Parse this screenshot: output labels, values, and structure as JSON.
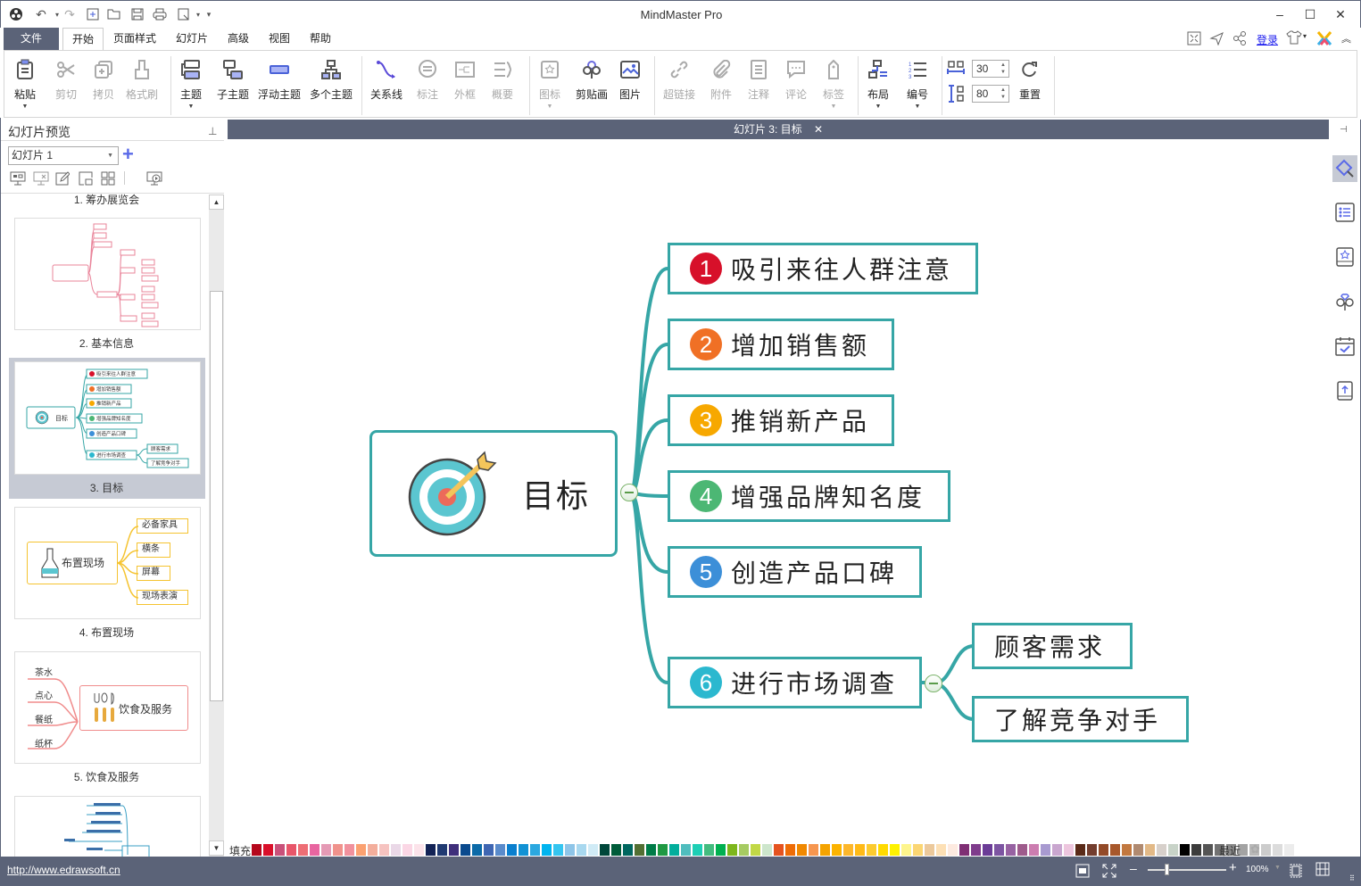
{
  "app": {
    "title": "MindMaster Pro"
  },
  "quick_access": [
    "app-logo",
    "undo",
    "redo",
    "new",
    "open",
    "save",
    "print",
    "export",
    "customize"
  ],
  "menu": {
    "file": "文件",
    "tabs": [
      "开始",
      "页面样式",
      "幻灯片",
      "高级",
      "视图",
      "帮助"
    ],
    "active": "开始",
    "login": "登录"
  },
  "ribbon": {
    "clipboard": [
      {
        "label": "粘贴",
        "enabled": true
      },
      {
        "label": "剪切",
        "enabled": false
      },
      {
        "label": "拷贝",
        "enabled": false
      },
      {
        "label": "格式刷",
        "enabled": false
      }
    ],
    "topics": [
      {
        "label": "主题"
      },
      {
        "label": "子主题"
      },
      {
        "label": "浮动主题"
      },
      {
        "label": "多个主题"
      }
    ],
    "insert": [
      {
        "label": "关系线",
        "enabled": true
      },
      {
        "label": "标注",
        "enabled": false
      },
      {
        "label": "外框",
        "enabled": false
      },
      {
        "label": "概要",
        "enabled": false
      }
    ],
    "media": [
      {
        "label": "图标",
        "enabled": false
      },
      {
        "label": "剪贴画",
        "enabled": true
      },
      {
        "label": "图片",
        "enabled": true
      }
    ],
    "attach": [
      {
        "label": "超链接"
      },
      {
        "label": "附件"
      },
      {
        "label": "注释"
      },
      {
        "label": "评论"
      },
      {
        "label": "标签"
      }
    ],
    "layout": [
      {
        "label": "布局"
      },
      {
        "label": "编号"
      }
    ],
    "spacing": {
      "horizontal": "30",
      "vertical": "80",
      "reset": "重置"
    }
  },
  "left_panel": {
    "title": "幻灯片预览",
    "slide_select": "幻灯片 1",
    "slides": [
      {
        "label": "1. 筹办展览会"
      },
      {
        "label": "2. 基本信息"
      },
      {
        "label": "3. 目标",
        "selected": true
      },
      {
        "label": "4. 布置现场",
        "center": "布置现场",
        "children": [
          "必备家具",
          "横条",
          "屏幕",
          "现场表演"
        ]
      },
      {
        "label": "5. 饮食及服务",
        "center": "饮食及服务",
        "children": [
          "茶水",
          "点心",
          "餐纸",
          "纸杯"
        ]
      }
    ]
  },
  "canvas": {
    "tab_title": "幻灯片 3: 目标",
    "root": "目标",
    "branches": [
      {
        "num": "1",
        "text": "吸引来往人群注意",
        "color": "#d7102a"
      },
      {
        "num": "2",
        "text": "增加销售额",
        "color": "#f07025"
      },
      {
        "num": "3",
        "text": "推销新产品",
        "color": "#f7a800"
      },
      {
        "num": "4",
        "text": "增强品牌知名度",
        "color": "#4cb774"
      },
      {
        "num": "5",
        "text": "创造产品口碑",
        "color": "#3c8fd8"
      },
      {
        "num": "6",
        "text": "进行市场调查",
        "color": "#2bb8cf",
        "children": [
          "顾客需求",
          "了解竞争对手"
        ]
      }
    ],
    "line_color": "#36a6a6"
  },
  "palette": {
    "label": "填充",
    "recent": "最近",
    "colors": [
      "#b5071c",
      "#d9102a",
      "#c9517a",
      "#e8566a",
      "#ee6e75",
      "#e865a0",
      "#e59ab5",
      "#f0928c",
      "#f1919d",
      "#fba171",
      "#f3ae9c",
      "#f6c3c0",
      "#ead8e7",
      "#fbd7e5",
      "#fce3ea",
      "#132356",
      "#203a72",
      "#3f2f7b",
      "#0a4a8e",
      "#0b6aa8",
      "#3f66b2",
      "#5a8bcb",
      "#0a7fce",
      "#1292d4",
      "#2ba8e0",
      "#00b4ef",
      "#34c5f0",
      "#8ec5e8",
      "#a8d8ef",
      "#d0ebf6",
      "#00473a",
      "#005c3a",
      "#00675f",
      "#526f33",
      "#007c48",
      "#1f9943",
      "#02ae9c",
      "#4fbdbe",
      "#1ecfb5",
      "#43bc7f",
      "#00b050",
      "#7db61c",
      "#a6cb62",
      "#c2d846",
      "#cde6cc",
      "#e5531f",
      "#ee6c06",
      "#f08800",
      "#f6964f",
      "#f4a300",
      "#fcb300",
      "#fdb72b",
      "#ffba17",
      "#fccb2f",
      "#ffda00",
      "#fef200",
      "#fef58c",
      "#fbd673",
      "#ecc99b",
      "#fde0b5",
      "#fdeae0",
      "#7f2f74",
      "#7f3c8c",
      "#6b3c97",
      "#7d55a2",
      "#9762a2",
      "#9e5b8c",
      "#cc7db0",
      "#a89ad0",
      "#c9a6cf",
      "#edc6de",
      "#5a2a18",
      "#733d2e",
      "#934a28",
      "#a8582b",
      "#c2783f",
      "#b08a70",
      "#e2b987",
      "#d7d0cb",
      "#c8d3c8",
      "#000000",
      "#3c3c3c",
      "#555555",
      "#727272",
      "#8a8a8a",
      "#a3a3a3",
      "#b8b8b8",
      "#cccccc",
      "#dcdcdc",
      "#ececec"
    ]
  },
  "status": {
    "url": "http://www.edrawsoft.cn",
    "zoom": "100%",
    "zoom_level": 0.25
  }
}
